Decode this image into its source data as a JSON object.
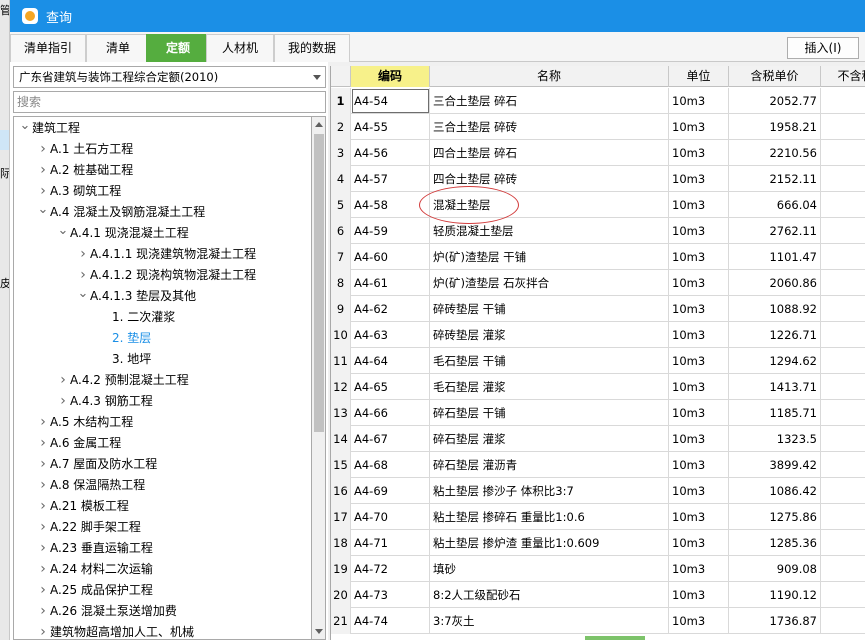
{
  "window": {
    "title": "查询"
  },
  "background": {
    "fragments": [
      "管",
      "际",
      "皮"
    ]
  },
  "tabs": [
    {
      "label": "清单指引",
      "active": false
    },
    {
      "label": "清单",
      "active": false
    },
    {
      "label": "定额",
      "active": true
    },
    {
      "label": "人材机",
      "active": false
    },
    {
      "label": "我的数据",
      "active": false
    }
  ],
  "toolbar": {
    "insert_label": "插入(I)"
  },
  "left": {
    "quota_selected": "广东省建筑与装饰工程综合定额(2010)",
    "search_placeholder": "搜索"
  },
  "tree": [
    {
      "label": "建筑工程",
      "level": 0,
      "expand": "down"
    },
    {
      "label": "A.1 土石方工程",
      "level": 1,
      "expand": "right"
    },
    {
      "label": "A.2 桩基础工程",
      "level": 1,
      "expand": "right"
    },
    {
      "label": "A.3 砌筑工程",
      "level": 1,
      "expand": "right"
    },
    {
      "label": "A.4 混凝土及钢筋混凝土工程",
      "level": 1,
      "expand": "down"
    },
    {
      "label": "A.4.1 现浇混凝土工程",
      "level": 2,
      "expand": "down"
    },
    {
      "label": "A.4.1.1 现浇建筑物混凝土工程",
      "level": 3,
      "expand": "right"
    },
    {
      "label": "A.4.1.2 现浇构筑物混凝土工程",
      "level": 3,
      "expand": "right"
    },
    {
      "label": "A.4.1.3 垫层及其他",
      "level": 3,
      "expand": "down"
    },
    {
      "label": "1. 二次灌浆",
      "level": 4,
      "expand": "none"
    },
    {
      "label": "2. 垫层",
      "level": 4,
      "expand": "none",
      "selected": true
    },
    {
      "label": "3. 地坪",
      "level": 4,
      "expand": "none"
    },
    {
      "label": "A.4.2 预制混凝土工程",
      "level": 2,
      "expand": "right"
    },
    {
      "label": "A.4.3 钢筋工程",
      "level": 2,
      "expand": "right"
    },
    {
      "label": "A.5 木结构工程",
      "level": 1,
      "expand": "right"
    },
    {
      "label": "A.6 金属工程",
      "level": 1,
      "expand": "right"
    },
    {
      "label": "A.7 屋面及防水工程",
      "level": 1,
      "expand": "right"
    },
    {
      "label": "A.8 保温隔热工程",
      "level": 1,
      "expand": "right"
    },
    {
      "label": "A.21 模板工程",
      "level": 1,
      "expand": "right"
    },
    {
      "label": "A.22 脚手架工程",
      "level": 1,
      "expand": "right"
    },
    {
      "label": "A.23 垂直运输工程",
      "level": 1,
      "expand": "right"
    },
    {
      "label": "A.24 材料二次运输",
      "level": 1,
      "expand": "right"
    },
    {
      "label": "A.25 成品保护工程",
      "level": 1,
      "expand": "right"
    },
    {
      "label": "A.26 混凝土泵送增加费",
      "level": 1,
      "expand": "right"
    },
    {
      "label": "建筑物超高增加人工、机械",
      "level": 1,
      "expand": "right"
    }
  ],
  "grid": {
    "columns": [
      "编码",
      "名称",
      "单位",
      "含税单价",
      "不含税"
    ],
    "rows": [
      {
        "n": "1",
        "code": "A4-54",
        "name": "三合土垫层 碎石",
        "unit": "10m3",
        "price": "2052.77",
        "extra": "2"
      },
      {
        "n": "2",
        "code": "A4-55",
        "name": "三合土垫层 碎砖",
        "unit": "10m3",
        "price": "1958.21",
        "extra": "1"
      },
      {
        "n": "3",
        "code": "A4-56",
        "name": "四合土垫层 碎石",
        "unit": "10m3",
        "price": "2210.56",
        "extra": "2"
      },
      {
        "n": "4",
        "code": "A4-57",
        "name": "四合土垫层 碎砖",
        "unit": "10m3",
        "price": "2152.11",
        "extra": "2"
      },
      {
        "n": "5",
        "code": "A4-58",
        "name": "混凝土垫层",
        "unit": "10m3",
        "price": "666.04",
        "extra": ""
      },
      {
        "n": "6",
        "code": "A4-59",
        "name": "轻质混凝土垫层",
        "unit": "10m3",
        "price": "2762.11",
        "extra": "2"
      },
      {
        "n": "7",
        "code": "A4-60",
        "name": "炉(矿)渣垫层 干铺",
        "unit": "10m3",
        "price": "1101.47",
        "extra": "1"
      },
      {
        "n": "8",
        "code": "A4-61",
        "name": "炉(矿)渣垫层 石灰拌合",
        "unit": "10m3",
        "price": "2060.86",
        "extra": "1"
      },
      {
        "n": "9",
        "code": "A4-62",
        "name": "碎砖垫层 干铺",
        "unit": "10m3",
        "price": "1088.92",
        "extra": "1"
      },
      {
        "n": "10",
        "code": "A4-63",
        "name": "碎砖垫层 灌浆",
        "unit": "10m3",
        "price": "1226.71",
        "extra": "1"
      },
      {
        "n": "11",
        "code": "A4-64",
        "name": "毛石垫层 干铺",
        "unit": "10m3",
        "price": "1294.62",
        "extra": "1"
      },
      {
        "n": "12",
        "code": "A4-65",
        "name": "毛石垫层 灌浆",
        "unit": "10m3",
        "price": "1413.71",
        "extra": "1"
      },
      {
        "n": "13",
        "code": "A4-66",
        "name": "碎石垫层 干铺",
        "unit": "10m3",
        "price": "1185.71",
        "extra": "1"
      },
      {
        "n": "14",
        "code": "A4-67",
        "name": "碎石垫层 灌浆",
        "unit": "10m3",
        "price": "1323.5",
        "extra": "1"
      },
      {
        "n": "15",
        "code": "A4-68",
        "name": "碎石垫层 灌沥青",
        "unit": "10m3",
        "price": "3899.42",
        "extra": "3"
      },
      {
        "n": "16",
        "code": "A4-69",
        "name": "粘土垫层 掺沙子 体积比3:7",
        "unit": "10m3",
        "price": "1086.42",
        "extra": "1"
      },
      {
        "n": "17",
        "code": "A4-70",
        "name": "粘土垫层 掺碎石 重量比1:0.6",
        "unit": "10m3",
        "price": "1275.86",
        "extra": "1"
      },
      {
        "n": "18",
        "code": "A4-71",
        "name": "粘土垫层 掺炉渣 重量比1:0.609",
        "unit": "10m3",
        "price": "1285.36",
        "extra": "1"
      },
      {
        "n": "19",
        "code": "A4-72",
        "name": "填砂",
        "unit": "10m3",
        "price": "909.08",
        "extra": ""
      },
      {
        "n": "20",
        "code": "A4-73",
        "name": "8:2人工级配砂石",
        "unit": "10m3",
        "price": "1190.12",
        "extra": "1"
      },
      {
        "n": "21",
        "code": "A4-74",
        "name": "3:7灰土",
        "unit": "10m3",
        "price": "1736.87",
        "extra": "1"
      }
    ]
  }
}
